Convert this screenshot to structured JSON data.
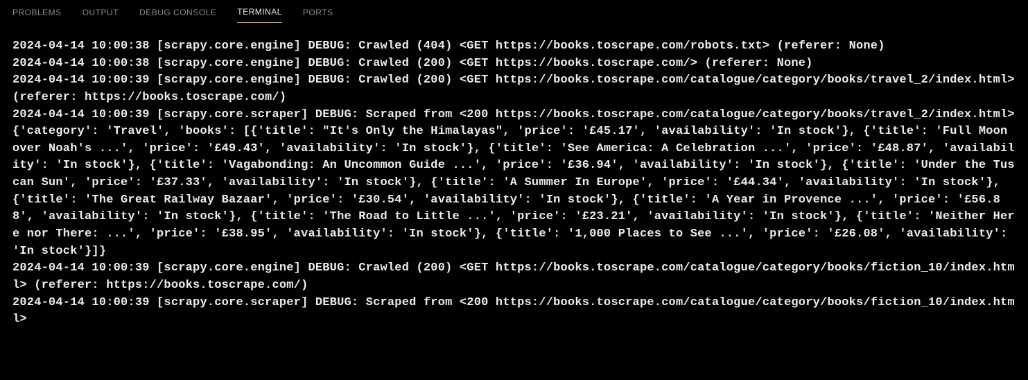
{
  "tabs": [
    {
      "label": "PROBLEMS",
      "active": false
    },
    {
      "label": "OUTPUT",
      "active": false
    },
    {
      "label": "DEBUG CONSOLE",
      "active": false
    },
    {
      "label": "TERMINAL",
      "active": true
    },
    {
      "label": "PORTS",
      "active": false
    }
  ],
  "terminal_output": "2024-04-14 10:00:38 [scrapy.core.engine] DEBUG: Crawled (404) <GET https://books.toscrape.com/robots.txt> (referer: None)\n2024-04-14 10:00:38 [scrapy.core.engine] DEBUG: Crawled (200) <GET https://books.toscrape.com/> (referer: None)\n2024-04-14 10:00:39 [scrapy.core.engine] DEBUG: Crawled (200) <GET https://books.toscrape.com/catalogue/category/books/travel_2/index.html> (referer: https://books.toscrape.com/)\n2024-04-14 10:00:39 [scrapy.core.scraper] DEBUG: Scraped from <200 https://books.toscrape.com/catalogue/category/books/travel_2/index.html>\n{'category': 'Travel', 'books': [{'title': \"It's Only the Himalayas\", 'price': '£45.17', 'availability': 'In stock'}, {'title': 'Full Moon over Noah's ...', 'price': '£49.43', 'availability': 'In stock'}, {'title': 'See America: A Celebration ...', 'price': '£48.87', 'availability': 'In stock'}, {'title': 'Vagabonding: An Uncommon Guide ...', 'price': '£36.94', 'availability': 'In stock'}, {'title': 'Under the Tuscan Sun', 'price': '£37.33', 'availability': 'In stock'}, {'title': 'A Summer In Europe', 'price': '£44.34', 'availability': 'In stock'}, {'title': 'The Great Railway Bazaar', 'price': '£30.54', 'availability': 'In stock'}, {'title': 'A Year in Provence ...', 'price': '£56.88', 'availability': 'In stock'}, {'title': 'The Road to Little ...', 'price': '£23.21', 'availability': 'In stock'}, {'title': 'Neither Here nor There: ...', 'price': '£38.95', 'availability': 'In stock'}, {'title': '1,000 Places to See ...', 'price': '£26.08', 'availability': 'In stock'}]}\n2024-04-14 10:00:39 [scrapy.core.engine] DEBUG: Crawled (200) <GET https://books.toscrape.com/catalogue/category/books/fiction_10/index.html> (referer: https://books.toscrape.com/)\n2024-04-14 10:00:39 [scrapy.core.scraper] DEBUG: Scraped from <200 https://books.toscrape.com/catalogue/category/books/fiction_10/index.html>"
}
